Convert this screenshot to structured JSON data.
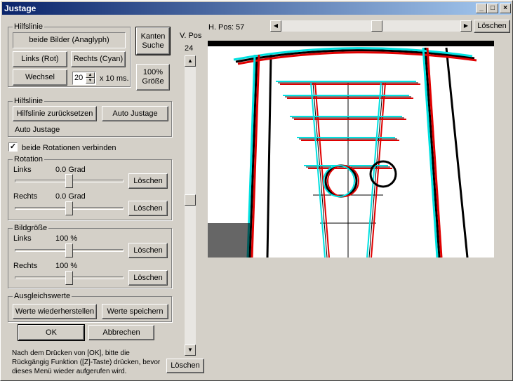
{
  "window": {
    "title": "Justage"
  },
  "hilfslinie1": {
    "caption": "Hilfslinie",
    "anaglyph": "beide Bilder (Anaglyph)",
    "links": "Links (Rot)",
    "rechts": "Rechts (Cyan)",
    "wechsel": "Wechsel",
    "interval_value": "20",
    "interval_unit": "x 10 ms."
  },
  "kanten_suche": "Kanten Suche",
  "groesse_100": "100% Größe",
  "vpos": {
    "label": "V. Pos",
    "value": "24",
    "clear": "Löschen"
  },
  "hpos": {
    "label": "H. Pos:",
    "value": "57",
    "clear": "Löschen"
  },
  "hilfslinie2": {
    "caption": "Hilfslinie",
    "reset": "Hilfslinie zurücksetzen",
    "auto": "Auto Justage",
    "status": "Auto Justage"
  },
  "rotation_link": "beide Rotationen verbinden",
  "rotation": {
    "caption": "Rotation",
    "links_label": "Links",
    "links_value": "0.0 Grad",
    "rechts_label": "Rechts",
    "rechts_value": "0.0 Grad",
    "clear": "Löschen"
  },
  "bildgroesse": {
    "caption": "Bildgröße",
    "links_label": "Links",
    "links_value": "100 %",
    "rechts_label": "Rechts",
    "rechts_value": "100 %",
    "clear": "Löschen"
  },
  "ausgleich": {
    "caption": "Ausgleichswerte",
    "restore": "Werte wiederherstellen",
    "save": "Werte speichern"
  },
  "ok": "OK",
  "cancel": "Abbrechen",
  "note": "Nach dem Drücken von [OK], bitte die Rückgängig Funktion ([Z]-Taste) drücken, bevor dieses Menü wieder aufgerufen wird.",
  "colors": {
    "title_start": "#0a246a",
    "title_end": "#a6caf0",
    "anaglyph_red": "#e00000",
    "anaglyph_cyan": "#00e0e0"
  }
}
